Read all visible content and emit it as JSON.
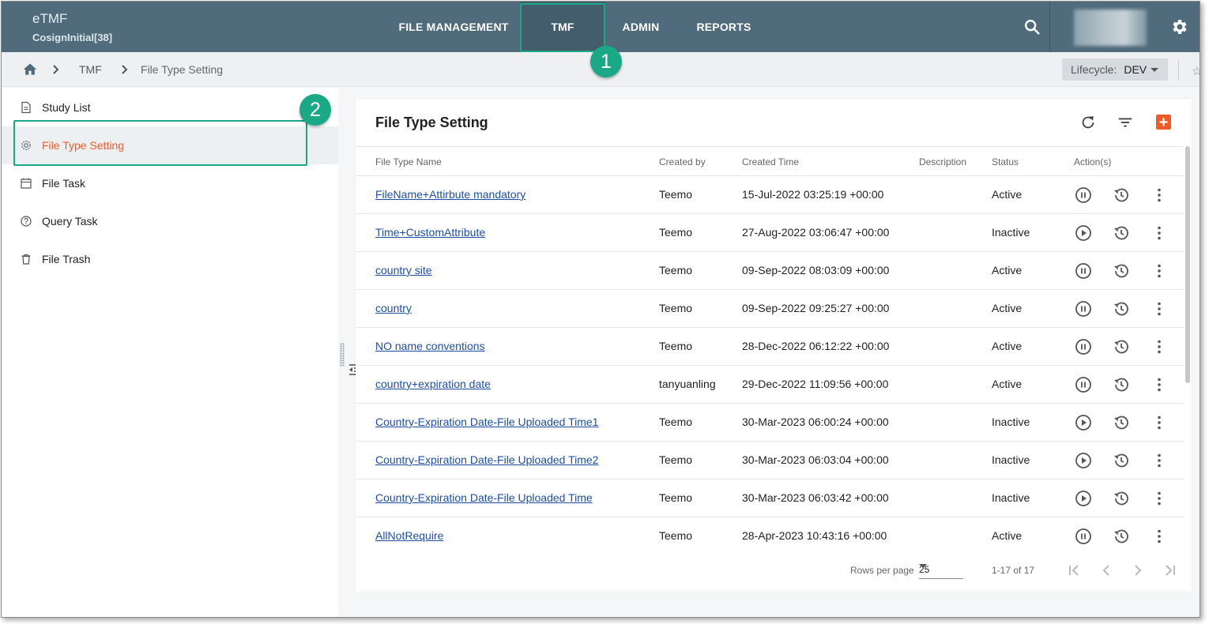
{
  "header": {
    "app_name": "eTMF",
    "study_name": "CosignInitial[38]",
    "nav": [
      {
        "label": "FILE MANAGEMENT"
      },
      {
        "label": "TMF"
      },
      {
        "label": "ADMIN"
      },
      {
        "label": "REPORTS"
      }
    ],
    "active_nav": "TMF"
  },
  "breadcrumb": {
    "items": [
      "TMF",
      "File Type Setting"
    ]
  },
  "lifecycle": {
    "label": "Lifecycle:",
    "value": "DEV"
  },
  "sidebar": {
    "items": [
      {
        "label": "Study List",
        "icon": "document-icon"
      },
      {
        "label": "File Type Setting",
        "icon": "gear-icon"
      },
      {
        "label": "File Task",
        "icon": "calendar-icon"
      },
      {
        "label": "Query Task",
        "icon": "help-circle-icon"
      },
      {
        "label": "File Trash",
        "icon": "trash-icon"
      }
    ],
    "active_item": "File Type Setting"
  },
  "annotations": [
    "1",
    "2"
  ],
  "main": {
    "title": "File Type Setting",
    "columns": [
      "File Type Name",
      "Created by",
      "Created Time",
      "Description",
      "Status",
      "Action(s)"
    ],
    "rows": [
      {
        "name": "FileName+Attirbute mandatory",
        "created_by": "Teemo",
        "created_time": "15-Jul-2022 03:25:19 +00:00",
        "description": "",
        "status": "Active"
      },
      {
        "name": "Time+CustomAttribute",
        "created_by": "Teemo",
        "created_time": "27-Aug-2022 03:06:47 +00:00",
        "description": "",
        "status": "Inactive"
      },
      {
        "name": "country site",
        "created_by": "Teemo",
        "created_time": "09-Sep-2022 08:03:09 +00:00",
        "description": "",
        "status": "Active"
      },
      {
        "name": "country",
        "created_by": "Teemo",
        "created_time": "09-Sep-2022 09:25:27 +00:00",
        "description": "",
        "status": "Active"
      },
      {
        "name": "NO name conventions",
        "created_by": "Teemo",
        "created_time": "28-Dec-2022 06:12:22 +00:00",
        "description": "",
        "status": "Active"
      },
      {
        "name": "country+expiration date",
        "created_by": "tanyuanling",
        "created_time": "29-Dec-2022 11:09:56 +00:00",
        "description": "",
        "status": "Active"
      },
      {
        "name": "Country-Expiration Date-File Uploaded Time1",
        "created_by": "Teemo",
        "created_time": "30-Mar-2023 06:00:24 +00:00",
        "description": "",
        "status": "Inactive"
      },
      {
        "name": "Country-Expiration Date-File Uploaded Time2",
        "created_by": "Teemo",
        "created_time": "30-Mar-2023 06:03:04 +00:00",
        "description": "",
        "status": "Inactive"
      },
      {
        "name": "Country-Expiration Date-File Uploaded Time",
        "created_by": "Teemo",
        "created_time": "30-Mar-2023 06:03:42 +00:00",
        "description": "",
        "status": "Inactive"
      },
      {
        "name": "AllNotRequire",
        "created_by": "Teemo",
        "created_time": "28-Apr-2023 10:43:16 +00:00",
        "description": "",
        "status": "Active"
      }
    ]
  },
  "pagination": {
    "rows_per_page_label": "Rows per page",
    "rows_per_page": "25",
    "range": "1-17 of 17"
  },
  "colors": {
    "header_bg": "#4f6b7c",
    "accent": "#f05a28",
    "annotation": "#1aa887",
    "link": "#1f4fa5"
  }
}
